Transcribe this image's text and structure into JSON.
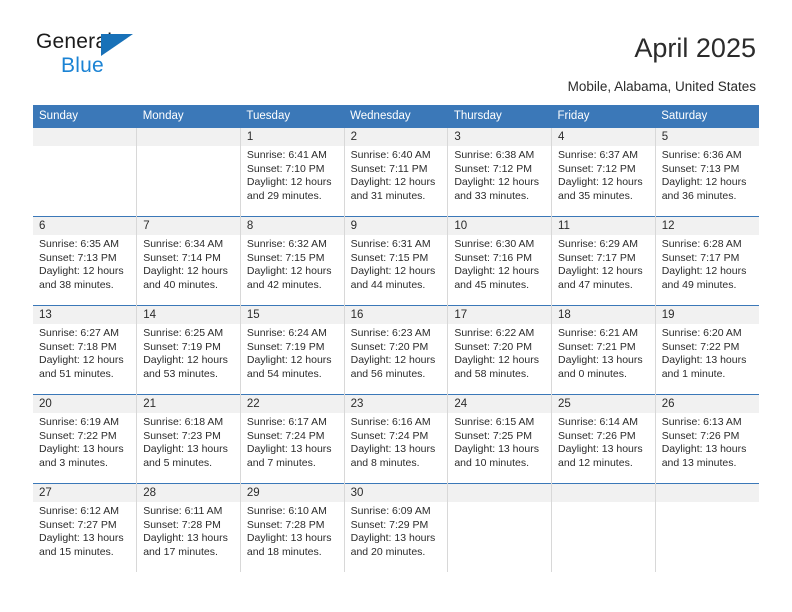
{
  "brand": {
    "name_part1": "General",
    "name_part2": "Blue",
    "triangle_color": "#1871b8",
    "blue_text_color": "#1b83d4"
  },
  "header": {
    "title": "April 2025",
    "subtitle": "Mobile, Alabama, United States"
  },
  "theme": {
    "header_blue": "#3b78b8",
    "date_strip_gray": "#f1f1f1",
    "text_color": "#2b2b2b"
  },
  "calendar": {
    "weekday_headers": [
      "Sunday",
      "Monday",
      "Tuesday",
      "Wednesday",
      "Thursday",
      "Friday",
      "Saturday"
    ],
    "weeks": [
      [
        {
          "day": "",
          "sunrise": "",
          "sunset": "",
          "daylight_line1": "",
          "daylight_line2": "",
          "empty": true
        },
        {
          "day": "",
          "sunrise": "",
          "sunset": "",
          "daylight_line1": "",
          "daylight_line2": "",
          "empty": true
        },
        {
          "day": "1",
          "sunrise": "Sunrise: 6:41 AM",
          "sunset": "Sunset: 7:10 PM",
          "daylight_line1": "Daylight: 12 hours",
          "daylight_line2": "and 29 minutes.",
          "empty": false
        },
        {
          "day": "2",
          "sunrise": "Sunrise: 6:40 AM",
          "sunset": "Sunset: 7:11 PM",
          "daylight_line1": "Daylight: 12 hours",
          "daylight_line2": "and 31 minutes.",
          "empty": false
        },
        {
          "day": "3",
          "sunrise": "Sunrise: 6:38 AM",
          "sunset": "Sunset: 7:12 PM",
          "daylight_line1": "Daylight: 12 hours",
          "daylight_line2": "and 33 minutes.",
          "empty": false
        },
        {
          "day": "4",
          "sunrise": "Sunrise: 6:37 AM",
          "sunset": "Sunset: 7:12 PM",
          "daylight_line1": "Daylight: 12 hours",
          "daylight_line2": "and 35 minutes.",
          "empty": false
        },
        {
          "day": "5",
          "sunrise": "Sunrise: 6:36 AM",
          "sunset": "Sunset: 7:13 PM",
          "daylight_line1": "Daylight: 12 hours",
          "daylight_line2": "and 36 minutes.",
          "empty": false
        }
      ],
      [
        {
          "day": "6",
          "sunrise": "Sunrise: 6:35 AM",
          "sunset": "Sunset: 7:13 PM",
          "daylight_line1": "Daylight: 12 hours",
          "daylight_line2": "and 38 minutes.",
          "empty": false
        },
        {
          "day": "7",
          "sunrise": "Sunrise: 6:34 AM",
          "sunset": "Sunset: 7:14 PM",
          "daylight_line1": "Daylight: 12 hours",
          "daylight_line2": "and 40 minutes.",
          "empty": false
        },
        {
          "day": "8",
          "sunrise": "Sunrise: 6:32 AM",
          "sunset": "Sunset: 7:15 PM",
          "daylight_line1": "Daylight: 12 hours",
          "daylight_line2": "and 42 minutes.",
          "empty": false
        },
        {
          "day": "9",
          "sunrise": "Sunrise: 6:31 AM",
          "sunset": "Sunset: 7:15 PM",
          "daylight_line1": "Daylight: 12 hours",
          "daylight_line2": "and 44 minutes.",
          "empty": false
        },
        {
          "day": "10",
          "sunrise": "Sunrise: 6:30 AM",
          "sunset": "Sunset: 7:16 PM",
          "daylight_line1": "Daylight: 12 hours",
          "daylight_line2": "and 45 minutes.",
          "empty": false
        },
        {
          "day": "11",
          "sunrise": "Sunrise: 6:29 AM",
          "sunset": "Sunset: 7:17 PM",
          "daylight_line1": "Daylight: 12 hours",
          "daylight_line2": "and 47 minutes.",
          "empty": false
        },
        {
          "day": "12",
          "sunrise": "Sunrise: 6:28 AM",
          "sunset": "Sunset: 7:17 PM",
          "daylight_line1": "Daylight: 12 hours",
          "daylight_line2": "and 49 minutes.",
          "empty": false
        }
      ],
      [
        {
          "day": "13",
          "sunrise": "Sunrise: 6:27 AM",
          "sunset": "Sunset: 7:18 PM",
          "daylight_line1": "Daylight: 12 hours",
          "daylight_line2": "and 51 minutes.",
          "empty": false
        },
        {
          "day": "14",
          "sunrise": "Sunrise: 6:25 AM",
          "sunset": "Sunset: 7:19 PM",
          "daylight_line1": "Daylight: 12 hours",
          "daylight_line2": "and 53 minutes.",
          "empty": false
        },
        {
          "day": "15",
          "sunrise": "Sunrise: 6:24 AM",
          "sunset": "Sunset: 7:19 PM",
          "daylight_line1": "Daylight: 12 hours",
          "daylight_line2": "and 54 minutes.",
          "empty": false
        },
        {
          "day": "16",
          "sunrise": "Sunrise: 6:23 AM",
          "sunset": "Sunset: 7:20 PM",
          "daylight_line1": "Daylight: 12 hours",
          "daylight_line2": "and 56 minutes.",
          "empty": false
        },
        {
          "day": "17",
          "sunrise": "Sunrise: 6:22 AM",
          "sunset": "Sunset: 7:20 PM",
          "daylight_line1": "Daylight: 12 hours",
          "daylight_line2": "and 58 minutes.",
          "empty": false
        },
        {
          "day": "18",
          "sunrise": "Sunrise: 6:21 AM",
          "sunset": "Sunset: 7:21 PM",
          "daylight_line1": "Daylight: 13 hours",
          "daylight_line2": "and 0 minutes.",
          "empty": false
        },
        {
          "day": "19",
          "sunrise": "Sunrise: 6:20 AM",
          "sunset": "Sunset: 7:22 PM",
          "daylight_line1": "Daylight: 13 hours",
          "daylight_line2": "and 1 minute.",
          "empty": false
        }
      ],
      [
        {
          "day": "20",
          "sunrise": "Sunrise: 6:19 AM",
          "sunset": "Sunset: 7:22 PM",
          "daylight_line1": "Daylight: 13 hours",
          "daylight_line2": "and 3 minutes.",
          "empty": false
        },
        {
          "day": "21",
          "sunrise": "Sunrise: 6:18 AM",
          "sunset": "Sunset: 7:23 PM",
          "daylight_line1": "Daylight: 13 hours",
          "daylight_line2": "and 5 minutes.",
          "empty": false
        },
        {
          "day": "22",
          "sunrise": "Sunrise: 6:17 AM",
          "sunset": "Sunset: 7:24 PM",
          "daylight_line1": "Daylight: 13 hours",
          "daylight_line2": "and 7 minutes.",
          "empty": false
        },
        {
          "day": "23",
          "sunrise": "Sunrise: 6:16 AM",
          "sunset": "Sunset: 7:24 PM",
          "daylight_line1": "Daylight: 13 hours",
          "daylight_line2": "and 8 minutes.",
          "empty": false
        },
        {
          "day": "24",
          "sunrise": "Sunrise: 6:15 AM",
          "sunset": "Sunset: 7:25 PM",
          "daylight_line1": "Daylight: 13 hours",
          "daylight_line2": "and 10 minutes.",
          "empty": false
        },
        {
          "day": "25",
          "sunrise": "Sunrise: 6:14 AM",
          "sunset": "Sunset: 7:26 PM",
          "daylight_line1": "Daylight: 13 hours",
          "daylight_line2": "and 12 minutes.",
          "empty": false
        },
        {
          "day": "26",
          "sunrise": "Sunrise: 6:13 AM",
          "sunset": "Sunset: 7:26 PM",
          "daylight_line1": "Daylight: 13 hours",
          "daylight_line2": "and 13 minutes.",
          "empty": false
        }
      ],
      [
        {
          "day": "27",
          "sunrise": "Sunrise: 6:12 AM",
          "sunset": "Sunset: 7:27 PM",
          "daylight_line1": "Daylight: 13 hours",
          "daylight_line2": "and 15 minutes.",
          "empty": false
        },
        {
          "day": "28",
          "sunrise": "Sunrise: 6:11 AM",
          "sunset": "Sunset: 7:28 PM",
          "daylight_line1": "Daylight: 13 hours",
          "daylight_line2": "and 17 minutes.",
          "empty": false
        },
        {
          "day": "29",
          "sunrise": "Sunrise: 6:10 AM",
          "sunset": "Sunset: 7:28 PM",
          "daylight_line1": "Daylight: 13 hours",
          "daylight_line2": "and 18 minutes.",
          "empty": false
        },
        {
          "day": "30",
          "sunrise": "Sunrise: 6:09 AM",
          "sunset": "Sunset: 7:29 PM",
          "daylight_line1": "Daylight: 13 hours",
          "daylight_line2": "and 20 minutes.",
          "empty": false
        },
        {
          "day": "",
          "sunrise": "",
          "sunset": "",
          "daylight_line1": "",
          "daylight_line2": "",
          "empty": true
        },
        {
          "day": "",
          "sunrise": "",
          "sunset": "",
          "daylight_line1": "",
          "daylight_line2": "",
          "empty": true
        },
        {
          "day": "",
          "sunrise": "",
          "sunset": "",
          "daylight_line1": "",
          "daylight_line2": "",
          "empty": true
        }
      ]
    ]
  }
}
